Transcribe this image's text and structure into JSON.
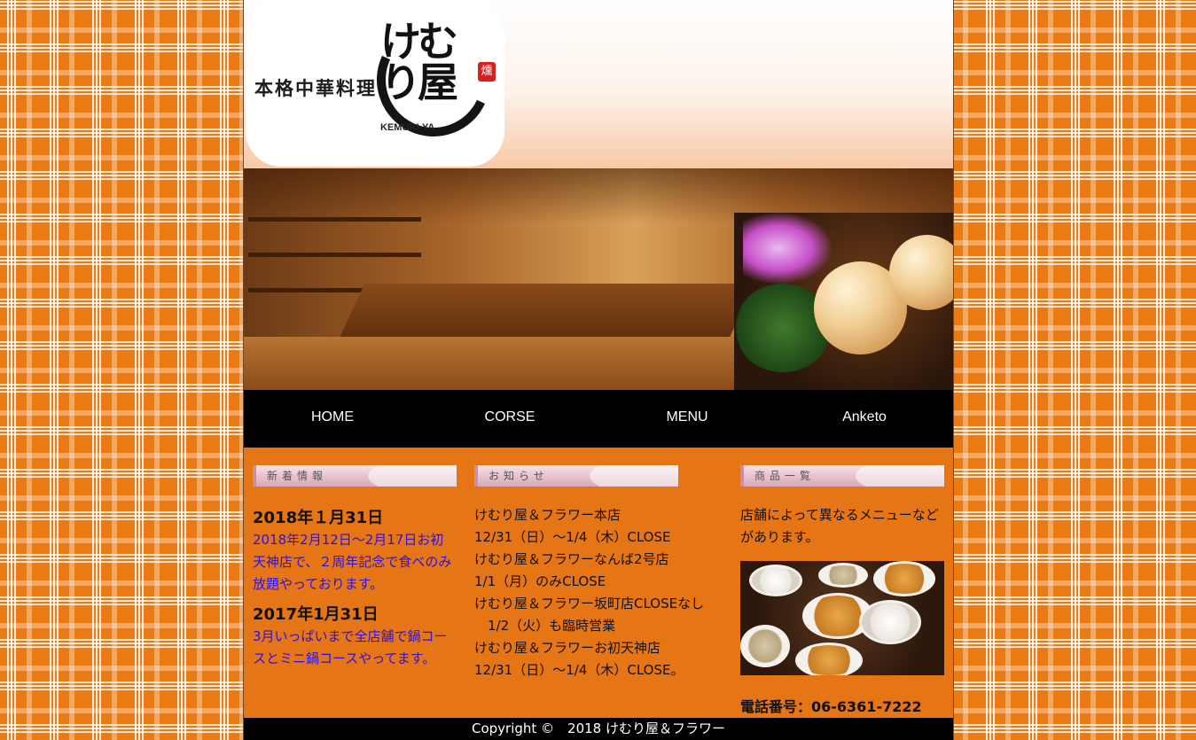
{
  "header": {
    "logo_sub": "本格中華料理",
    "logo_main": "けむり屋",
    "logo_en": "KEMURI-YA",
    "logo_seal": "燻"
  },
  "nav": [
    "HOME",
    "CORSE",
    "MENU",
    "Anketo"
  ],
  "columns": {
    "news": {
      "heading": "新着情報",
      "items": [
        {
          "date": "2018年１月31日",
          "text": "2018年2月12日～2月17日お初天神店で、２周年記念で食べのみ放題やっております。"
        },
        {
          "date": "2017年1月31日",
          "text": "3月いっぱいまで全店舗で鍋コースとミニ鍋コースやってます。"
        }
      ]
    },
    "notice": {
      "heading": "お知らせ",
      "lines": [
        "けむり屋＆フラワー本店",
        "12/31（日）～1/4（木）CLOSE",
        "けむり屋＆フラワーなんば2号店",
        "1/1（月）のみCLOSE",
        "けむり屋＆フラワー坂町店CLOSEなし",
        "　1/2（火）も臨時営業",
        "けむり屋＆フラワーお初天神店",
        "12/31（日）～1/4（木）CLOSE。"
      ]
    },
    "products": {
      "heading": "商品一覧",
      "text": "店舗によって異なるメニューなどがあります。",
      "phone": "電話番号：06-6361-7222"
    }
  },
  "footer": {
    "copyright": "Copyright ©　2018 けむり屋＆フラワー"
  },
  "colors": {
    "page_orange": "#ec7a13",
    "nav_bg": "#000000",
    "news_text": "#2b11e6"
  }
}
